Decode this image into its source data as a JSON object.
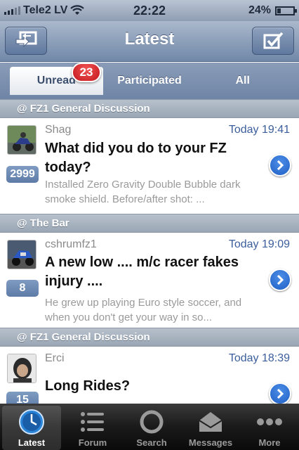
{
  "status_bar": {
    "carrier": "Tele2 LV",
    "time": "22:22",
    "battery": "24%",
    "battery_level": 0.24
  },
  "nav": {
    "title": "Latest",
    "left_icon": "switch-arrows-icon",
    "right_icon": "mark-read-checkbox-icon"
  },
  "tabs": {
    "items": [
      {
        "label": "Unread"
      },
      {
        "label": "Participated"
      },
      {
        "label": "All"
      }
    ],
    "active": "Unread",
    "unread_badge": "23"
  },
  "sections": [
    {
      "label": "@ FZ1 General Discussion"
    },
    {
      "label": "@ The Bar"
    },
    {
      "label": "@ FZ1 General Discussion"
    }
  ],
  "topics": [
    {
      "author": "Shag",
      "time": "Today 19:41",
      "title": "What did you do to your FZ today?",
      "preview": "Installed Zero Gravity Double Bubble dark smoke shield. Before/after shot: ...",
      "count": "2999",
      "avatar": "motorcycle-photo"
    },
    {
      "author": "cshrumfz1",
      "time": "Today 19:09",
      "title": "A new low .... m/c racer fakes injury ....",
      "preview": "He grew up playing Euro style soccer, and when you don't get your way in so...",
      "count": "8",
      "avatar": "blue-motorcycle-photo"
    },
    {
      "author": "Erci",
      "time": "Today 18:39",
      "title": "Long Rides?",
      "preview": "",
      "count": "15",
      "avatar": "rider-helmet-photo"
    }
  ],
  "tab_bar": {
    "items": [
      {
        "label": "Latest",
        "icon": "clock-icon"
      },
      {
        "label": "Forum",
        "icon": "list-icon"
      },
      {
        "label": "Search",
        "icon": "search-icon"
      },
      {
        "label": "Messages",
        "icon": "envelope-icon"
      },
      {
        "label": "More",
        "icon": "more-dots-icon"
      }
    ],
    "active": "Latest"
  },
  "colors": {
    "nav_blue": "#7188a8",
    "badge_red": "#c4161c",
    "time_blue": "#3b5e9c",
    "disclosure_blue": "#1f5fc4"
  }
}
